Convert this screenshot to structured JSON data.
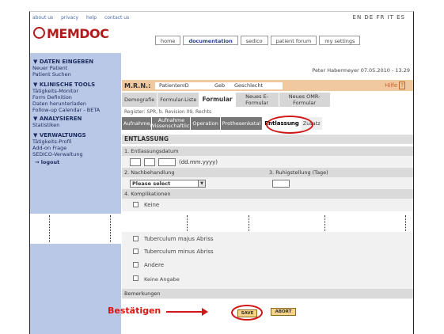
{
  "top_links": [
    "about us",
    "privacy",
    "help",
    "contact us"
  ],
  "languages": "EN DE FR IT ES",
  "logo_text": "MEMDOC",
  "nav": [
    "home",
    "documentation",
    "sedico",
    "patient forum",
    "my settings"
  ],
  "user_line": "Peter Habermeyer  07.05.2010 - 13.29",
  "sidebar": {
    "groups": [
      {
        "title": "DATEN EINGEBEN",
        "items": [
          "Neuer Patient",
          "Patient Suchen"
        ]
      },
      {
        "title": "KLINISCHE TOOLS",
        "items": [
          "Tätigkeits-Monitor",
          "Form Definition",
          "Daten herunterladen",
          "Follow-up Calendar - BETA"
        ]
      },
      {
        "title": "ANALYSIEREN",
        "items": [
          "Statistiken"
        ]
      },
      {
        "title": "VERWALTUNGS",
        "items": [
          "Tätigkeits-Profil",
          "Add-on Frage",
          "SEDICO-Verwaltung"
        ]
      }
    ],
    "logout": "→ logout"
  },
  "mrn": {
    "label": "M.R.N.:",
    "patient_id": "PatientenID",
    "geb": "Geb",
    "geschlecht": "Geschlecht",
    "hilfe": "Hilfe"
  },
  "tabs": [
    "Demografie",
    "Formular-Liste",
    "Formular",
    "Neues E-Formular",
    "Neues OMR-Formular"
  ],
  "register_line": "Register: SPR, b. Revision 09, Rechts",
  "subtabs": [
    "Aufnahme",
    "Aufnahme Wissenschaftlich",
    "Operation",
    "Prothesenkatal",
    "Entlassung",
    "Zusatz"
  ],
  "form": {
    "title": "ENTLASSUNG",
    "s1": "1. Entlassungsdatum",
    "date_hint": "(dd.mm.yyyy)",
    "s2": "2. Nachbehandlung",
    "s3": "3. Ruhigstellung (Tage)",
    "select_value": "Please select",
    "s4": "4. Komplikationen",
    "cb_keine": "Keine",
    "cb_majus": "Tuberculum majus Abriss",
    "cb_minus": "Tuberculum minus Abriss",
    "cb_andere": "Andere",
    "cb_keine_angabe": "Keine Angabe",
    "bemerkungen": "Bemerkungen"
  },
  "annotation": "Bestätigen",
  "buttons": {
    "save": "SAVE",
    "abort": "ABORT"
  }
}
